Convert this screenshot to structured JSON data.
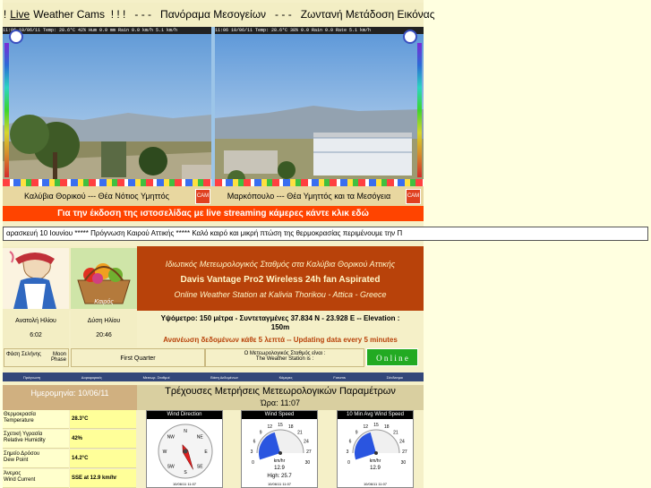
{
  "header": {
    "prefix": "! ! !",
    "live_link": "Live",
    "middle": "Weather Cams  ! ! !   - - -   Πανόραμα Μεσογείων   - - -   Ζωντανή Μετάδοση Εικόνας"
  },
  "cams": {
    "left_strip": "11:06 10/06/11 Temp: 28.6°C  42% Hum  0.0 mm Rain  0.0 km/h  5.1 km/h",
    "right_strip": "11:06 10/06/11 Temp: 28.6°C  38%  0.0  Rain  0.0  Rate  5.1 km/h",
    "left_caption": "Καλύβια Θορικού --- Θέα Νότιος Υμηττός",
    "right_caption": "Μαρκόπουλο --- Θέα Υμηττός και τα Μεσόγεια",
    "cam_icon_text": "CAM"
  },
  "streaming_banner": "Για την έκδοση της ιστοσελίδας με live streaming κάμερες κάντε κλικ εδώ",
  "ticker": {
    "text": "αρασκευή 10 Ιουνίου      *****      Πρόγνωση Καιρού Αττικής      *****      Καλό καιρό και μικρή πτώση της θερμοκρασίας περιμένουμε την Π"
  },
  "logos": {
    "right_logo_text": "Καιρός"
  },
  "station": {
    "greek_title": "Ιδιωτικός Μετεωρολογικός Σταθμός στα Καλύβια Θορικού Αττικής",
    "model": "Davis Vantage Pro2 Wireless  24h fan Aspirated",
    "english_title": "Online Weather Station at Kalivia Thorikou - Attica - Greece"
  },
  "sun": {
    "sunrise_label": "Ανατολή Ηλίου",
    "sunrise_time": "6:02",
    "sunset_label": "Δύση Ηλίου",
    "sunset_time": "20:46"
  },
  "location": {
    "line1": "Υψόμετρο: 150 μέτρα  -  Συντεταγμένες 37.834 N - 23.928 E  --  Elevation :",
    "line2": "150m",
    "update": "Ανανέωση δεδομένων κάθε 5 λεπτά  --  Updating data every 5 minutes"
  },
  "moon": {
    "label_gr": "Φάση Σελήνης",
    "label_en": "Moon Phase",
    "phase": "First Quarter"
  },
  "status": {
    "label": "Ο Μετεωρολογικός Σταθμός είναι :",
    "label_en": "The Weather Station is :",
    "value": "O n l i n e",
    "color": "#22aa22"
  },
  "nav": {
    "items": [
      "Πρόγνωση",
      "Δορυφορικές",
      "Μετεωρ. Σταθμοί",
      "Βάση Δεδομένων",
      "Κάμερες",
      "Forums",
      "Σύνδεσμοι"
    ]
  },
  "date": {
    "label": "Ημερομηνία: 10/06/11",
    "title": "Τρέχουσες Μετρήσεις Μετεωρολογικών Παραμέτρων",
    "time": "Ώρα: 11:07"
  },
  "measurements": [
    {
      "label_gr": "Θερμοκρασία",
      "label_en": "Temperature",
      "value": "28.3°C"
    },
    {
      "label_gr": "Σχετική Υγρασία",
      "label_en": "Relative Humidity",
      "value": "42%"
    },
    {
      "label_gr": "Σημείο Δρόσου",
      "label_en": "Dew Point",
      "value": "14.2°C"
    },
    {
      "label_gr": "Άνεμος",
      "label_en": "Wind Current",
      "value": "SSE at 12.9 km/hr"
    }
  ],
  "gauges": {
    "wind_direction": {
      "title": "Wind Direction",
      "footer": "10/06/11    11:07",
      "bearing_deg": 157,
      "labels": [
        "N",
        "NE",
        "E",
        "SE",
        "S",
        "SW",
        "W",
        "NW"
      ]
    },
    "wind_speed": {
      "title": "Wind Speed",
      "unit": "km/hr",
      "value": "12.9",
      "high": "High: 25.7",
      "footer": "10/06/11    11:07",
      "level": 12.9,
      "max": 30,
      "ticks": [
        "0",
        "3",
        "6",
        "9",
        "12",
        "15",
        "18",
        "21",
        "24",
        "27",
        "30"
      ]
    },
    "avg_wind": {
      "title": "10 Min Avg Wind Speed",
      "unit": "km/hr",
      "value": "12.9",
      "footer": "10/06/11    11:07",
      "level": 12.9,
      "max": 30,
      "ticks": [
        "0",
        "3",
        "6",
        "9",
        "12",
        "15",
        "18",
        "21",
        "24",
        "27",
        "30"
      ]
    }
  },
  "colors": {
    "orange_bar": "#ff4400",
    "station_bg": "#b8420a",
    "nav_bg": "#33477a"
  }
}
